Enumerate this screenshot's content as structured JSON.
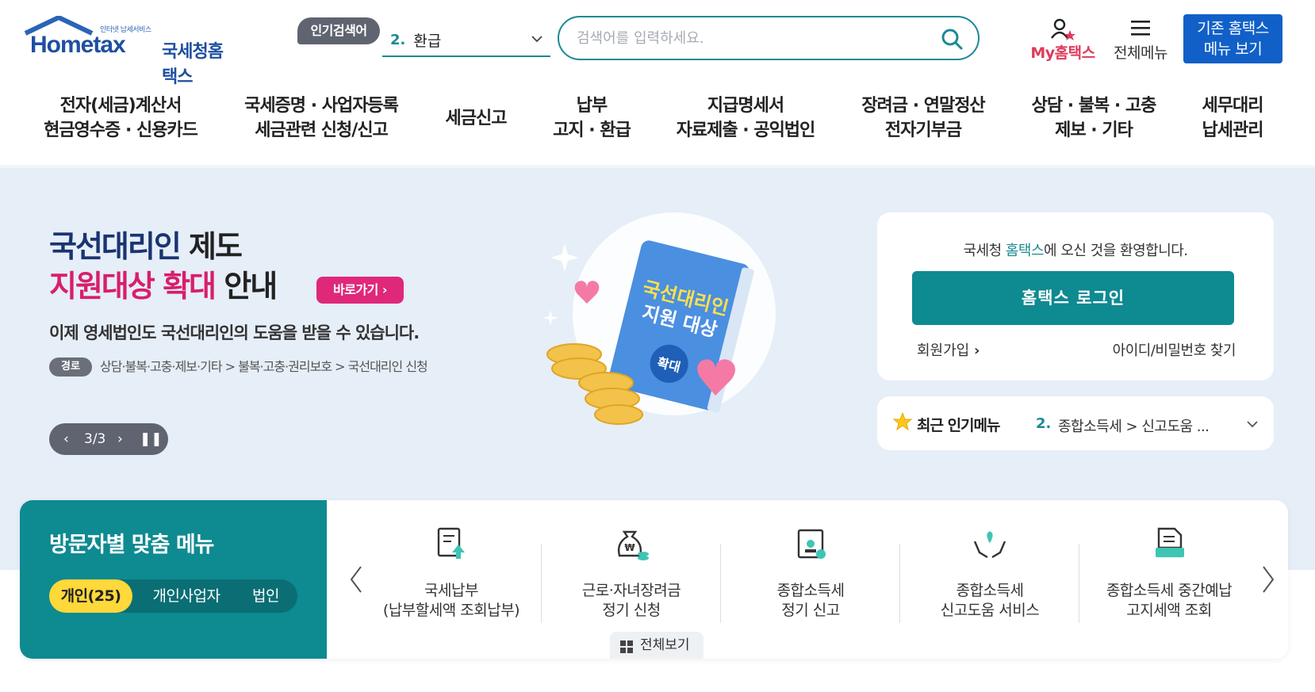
{
  "header": {
    "logo_tag": "인터넷 납세서비스",
    "logo_brand": "Hometax",
    "logo_kr": "국세청홈택스",
    "popular_label": "인기검색어",
    "popular_num": "2.",
    "popular_value": "환급",
    "search_placeholder": "검색어를 입력하세요.",
    "my_label": "My홈택스",
    "allmenu_label": "전체메뉴",
    "oldmenu_line1": "기존 홈택스",
    "oldmenu_line2": "메뉴 보기"
  },
  "nav": [
    {
      "l1": "전자(세금)계산서",
      "l2": "현금영수증 · 신용카드"
    },
    {
      "l1": "국세증명 · 사업자등록",
      "l2": "세금관련 신청/신고"
    },
    {
      "l1": "세금신고",
      "l2": ""
    },
    {
      "l1": "납부",
      "l2": "고지 · 환급"
    },
    {
      "l1": "지급명세서",
      "l2": "자료제출 · 공익법인"
    },
    {
      "l1": "장려금 · 연말정산",
      "l2": "전자기부금"
    },
    {
      "l1": "상담 · 불복 · 고충",
      "l2": "제보 · 기타"
    },
    {
      "l1": "세무대리",
      "l2": "납세관리"
    }
  ],
  "hero": {
    "title_l1a": "국선대리인",
    "title_l1b": " 제도",
    "title_l2a": "지원대상 확대",
    "title_l2b": " 안내",
    "goto_label": "바로가기",
    "subtitle": "이제 영세법인도 국선대리인의 도움을 받을 수 있습니다.",
    "path_badge": "경로",
    "path": "상담·불복·고충·제보·기타 > 불복·고충·권리보호 > 국선대리인 신청",
    "pager_count": "3/3",
    "book_line1": "국선대리인",
    "book_line2": "지원 대상",
    "book_badge": "확대"
  },
  "login": {
    "welcome_a": "국세청 ",
    "welcome_hl": "홈택스",
    "welcome_b": "에 오신 것을 환영합니다.",
    "button": "홈택스 로그인",
    "join": "회원가입",
    "find": "아이디/비밀번호 찾기"
  },
  "recent": {
    "label": "최근 인기메뉴",
    "num": "2.",
    "value": "종합소득세 > 신고도움 ..."
  },
  "visitor": {
    "title": "방문자별 맞춤 메뉴",
    "tabs": [
      "개인(25)",
      "개인사업자",
      "법인"
    ],
    "items": [
      {
        "l1": "국세납부",
        "l2": "(납부할세액 조회납부)"
      },
      {
        "l1": "근로·자녀장려금",
        "l2": "정기 신청"
      },
      {
        "l1": "종합소득세",
        "l2": "정기 신고"
      },
      {
        "l1": "종합소득세",
        "l2": "신고도움 서비스"
      },
      {
        "l1": "종합소득세 중간예납",
        "l2": "고지세액 조회"
      }
    ],
    "view_all": "전체보기"
  },
  "colors": {
    "teal": "#0e8a91",
    "navy": "#1a3470",
    "pink": "#d81e6a",
    "blue_btn": "#1060c8",
    "hero_bg": "#e6eef8"
  }
}
